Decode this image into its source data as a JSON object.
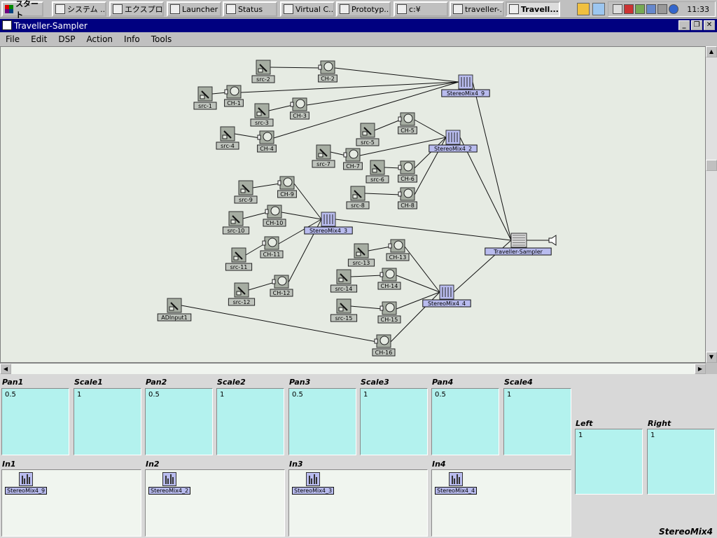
{
  "taskbar": {
    "start_label": "スタート",
    "tasks": [
      "システム ...",
      "エクスプロ...",
      "Launcher",
      "Status",
      "Virtual C...",
      "Prototyp...",
      "c:¥",
      "traveller-...",
      "Travell..."
    ],
    "clock": "11:33"
  },
  "window": {
    "title": "Traveller-Sampler",
    "menu": [
      "File",
      "Edit",
      "DSP",
      "Action",
      "Info",
      "Tools"
    ]
  },
  "graph": {
    "sources": [
      "src-1",
      "src-2",
      "src-3",
      "src-4",
      "src-5",
      "src-6",
      "src-7",
      "src-8",
      "src-9",
      "src-10",
      "src-11",
      "src-12",
      "src-13",
      "src-14",
      "src-15",
      "ADInput1"
    ],
    "channels": [
      "CH-1",
      "CH-2",
      "CH-3",
      "CH-4",
      "CH-5",
      "CH-6",
      "CH-7",
      "CH-8",
      "CH-9",
      "CH-10",
      "CH-11",
      "CH-12",
      "CH-13",
      "CH-14",
      "CH-15",
      "CH-16"
    ],
    "mixers": [
      "StereoMix4_9",
      "StereoMix4_2",
      "StereoMix4_3",
      "StereoMix4_4"
    ],
    "output": "Traveller-Sampler"
  },
  "params": {
    "pan1": {
      "label": "Pan1",
      "value": "0.5"
    },
    "scale1": {
      "label": "Scale1",
      "value": "1"
    },
    "pan2": {
      "label": "Pan2",
      "value": "0.5"
    },
    "scale2": {
      "label": "Scale2",
      "value": "1"
    },
    "pan3": {
      "label": "Pan3",
      "value": "0.5"
    },
    "scale3": {
      "label": "Scale3",
      "value": "1"
    },
    "pan4": {
      "label": "Pan4",
      "value": "0.5"
    },
    "scale4": {
      "label": "Scale4",
      "value": "1"
    },
    "left": {
      "label": "Left",
      "value": "1"
    },
    "right": {
      "label": "Right",
      "value": "1"
    }
  },
  "inputs": {
    "in1": {
      "label": "In1",
      "chip": "StereoMix4_9"
    },
    "in2": {
      "label": "In2",
      "chip": "StereoMix4_2"
    },
    "in3": {
      "label": "In3",
      "chip": "StereoMix4_3"
    },
    "in4": {
      "label": "In4",
      "chip": "StereoMix4_4"
    }
  },
  "footer": "StereoMix4",
  "colors": {
    "titlebar": "#000080",
    "param_box": "#b3f2ee",
    "mixer": "#b9bcef",
    "canvas": "#e6ebe3"
  }
}
